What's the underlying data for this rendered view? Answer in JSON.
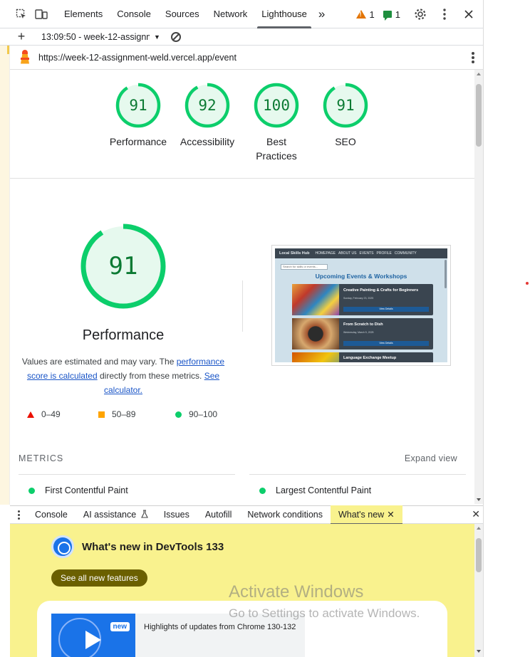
{
  "tabbar": {
    "tabs": [
      "Elements",
      "Console",
      "Sources",
      "Network",
      "Lighthouse"
    ],
    "active_tab": "Lighthouse",
    "more": "»",
    "warnings_count": "1",
    "issues_count": "1"
  },
  "report": {
    "plus": "+",
    "selected_report": "13:09:50 - week-12-assignme",
    "url": "https://week-12-assignment-weld.vercel.app/event"
  },
  "scores": [
    {
      "label": "Performance",
      "value": "91"
    },
    {
      "label": "Accessibility",
      "value": "92"
    },
    {
      "label": "Best Practices",
      "value": "100"
    },
    {
      "label": "SEO",
      "value": "91"
    }
  ],
  "best_practices_lines": [
    "Best",
    "Practices"
  ],
  "performance": {
    "score": "91",
    "title": "Performance",
    "desc_1": "Values are estimated and may vary. The ",
    "desc_link_1": "performance score is calculated",
    "desc_2": " directly from these metrics. ",
    "desc_link_2": "See calculator.",
    "legend": {
      "red": "0–49",
      "orange": "50–89",
      "green": "90–100"
    }
  },
  "screenshot": {
    "brand": "Local Skills Hub",
    "nav_items": [
      "HOMEPAGE",
      "ABOUT US",
      "EVENTS",
      "PROFILE",
      "COMMUNITY"
    ],
    "search_placeholder": "Search for skills or events...",
    "heading": "Upcoming Events & Workshops",
    "events": [
      {
        "title": "Creative Painting & Crafts for Beginners",
        "date": "Sunday, February 23, 2025",
        "button": "View Details"
      },
      {
        "title": "From Scratch to Dish",
        "date": "Wednesday, March 5, 2025",
        "button": "View Details"
      },
      {
        "title": "Language Exchange Meetup",
        "date": "",
        "button": ""
      }
    ]
  },
  "metrics": {
    "title": "METRICS",
    "expand": "Expand view",
    "items": [
      "First Contentful Paint",
      "Largest Contentful Paint"
    ]
  },
  "drawer": {
    "tabs": [
      "Console",
      "AI assistance",
      "Issues",
      "Autofill",
      "Network conditions",
      "What's new"
    ],
    "active_tab": "What's new",
    "ai_icon": "flask-icon"
  },
  "whats_new": {
    "title": "What's new in DevTools 133",
    "button": "See all new features",
    "badge": "new",
    "highlight": "Highlights of updates from Chrome 130-132"
  },
  "watermark": {
    "line1": "Activate Windows",
    "line2": "Go to Settings to activate Windows."
  },
  "colors": {
    "pass_green": "#0cce6b",
    "score_text": "#0b7a33",
    "whats_new_bg": "#f9f28e",
    "accent_blue": "#1a73e8"
  }
}
